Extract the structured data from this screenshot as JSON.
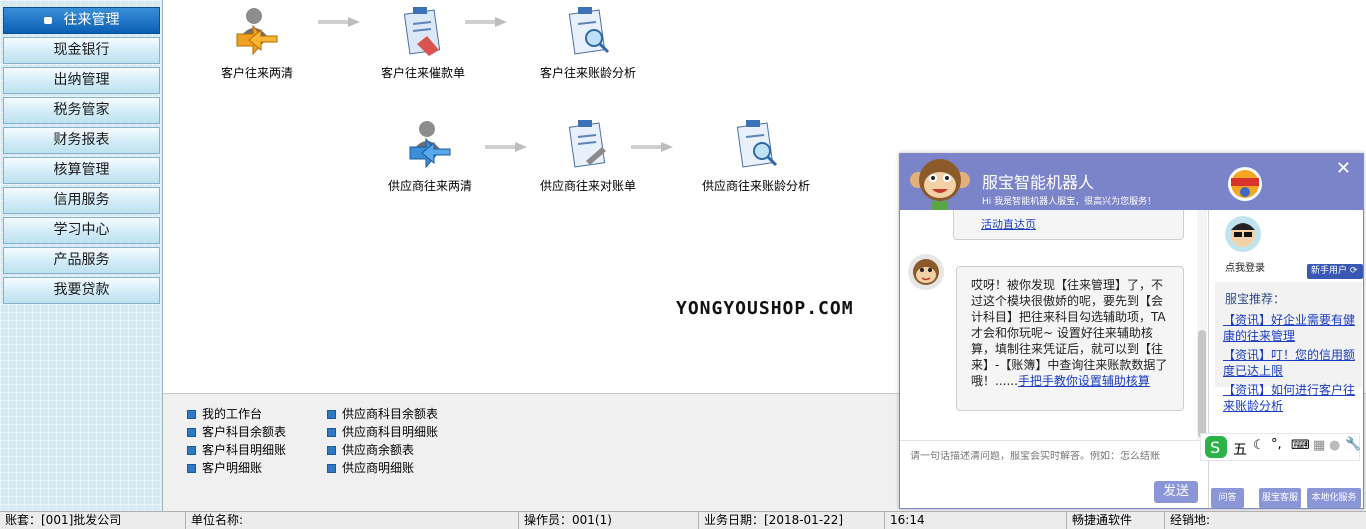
{
  "sidebar": {
    "items": [
      {
        "label": "往来管理",
        "active": true
      },
      {
        "label": "现金银行"
      },
      {
        "label": "出纳管理"
      },
      {
        "label": "税务管家"
      },
      {
        "label": "财务报表"
      },
      {
        "label": "核算管理"
      },
      {
        "label": "信用服务"
      },
      {
        "label": "学习中心"
      },
      {
        "label": "产品服务"
      },
      {
        "label": "我要贷款"
      }
    ]
  },
  "workflow": {
    "row1": [
      "客户往来两清",
      "客户往来催款单",
      "客户往来账龄分析"
    ],
    "row2": [
      "供应商往来两清",
      "供应商往来对账单",
      "供应商往来账龄分析"
    ],
    "watermark": "YONGYOUSHOP.COM"
  },
  "reports": {
    "col1": [
      "我的工作台",
      "客户科目余额表",
      "客户科目明细账",
      "客户明细账"
    ],
    "col2": [
      "供应商科目余额表",
      "供应商科目明细账",
      "供应商余额表",
      "供应商明细账"
    ]
  },
  "statusbar": {
    "account": "账套：[001]批发公司",
    "unit": "单位名称:",
    "operator": "操作员：001(1)",
    "date": "业务日期：[2018-01-22]",
    "time": "16:14",
    "software": "畅捷通软件",
    "dealer": "经销地:"
  },
  "chat": {
    "title": "服宝智能机器人",
    "subtitle": "Hi 我是智能机器人服宝，很高兴为您服务！",
    "close": "✕",
    "prev_link": "活动直达页",
    "message_text": "哎呀！被你发现【往来管理】了，不过这个模块很傲娇的呢，要先到【会计科目】把往来科目勾选辅助项，TA才会和你玩呢~ 设置好往来辅助核算，填制往来凭证后，就可以到【往来】-【账簿】中查询往来账款数据了哦！......",
    "message_link": "手把手教你设置辅助核算",
    "input_placeholder": "请一句话描述清问题，服宝会实时解答。例如：怎么结账",
    "send": "发送",
    "login": "点我登录",
    "newbie": "新手用户",
    "rec_title": "服宝推荐：",
    "recommendations": [
      "【资讯】好企业需要有健康的往来管理",
      "【资讯】叮！您的信用额度已达上限",
      "【资讯】如何进行客户往来账龄分析"
    ],
    "tabs": [
      "问答",
      "服宝客服",
      "本地化服务"
    ],
    "ime_char": "五"
  },
  "colors": {
    "nav_active": "#0a5fb4",
    "chat_header": "#7b83c9",
    "link": "#1a3dc1"
  }
}
